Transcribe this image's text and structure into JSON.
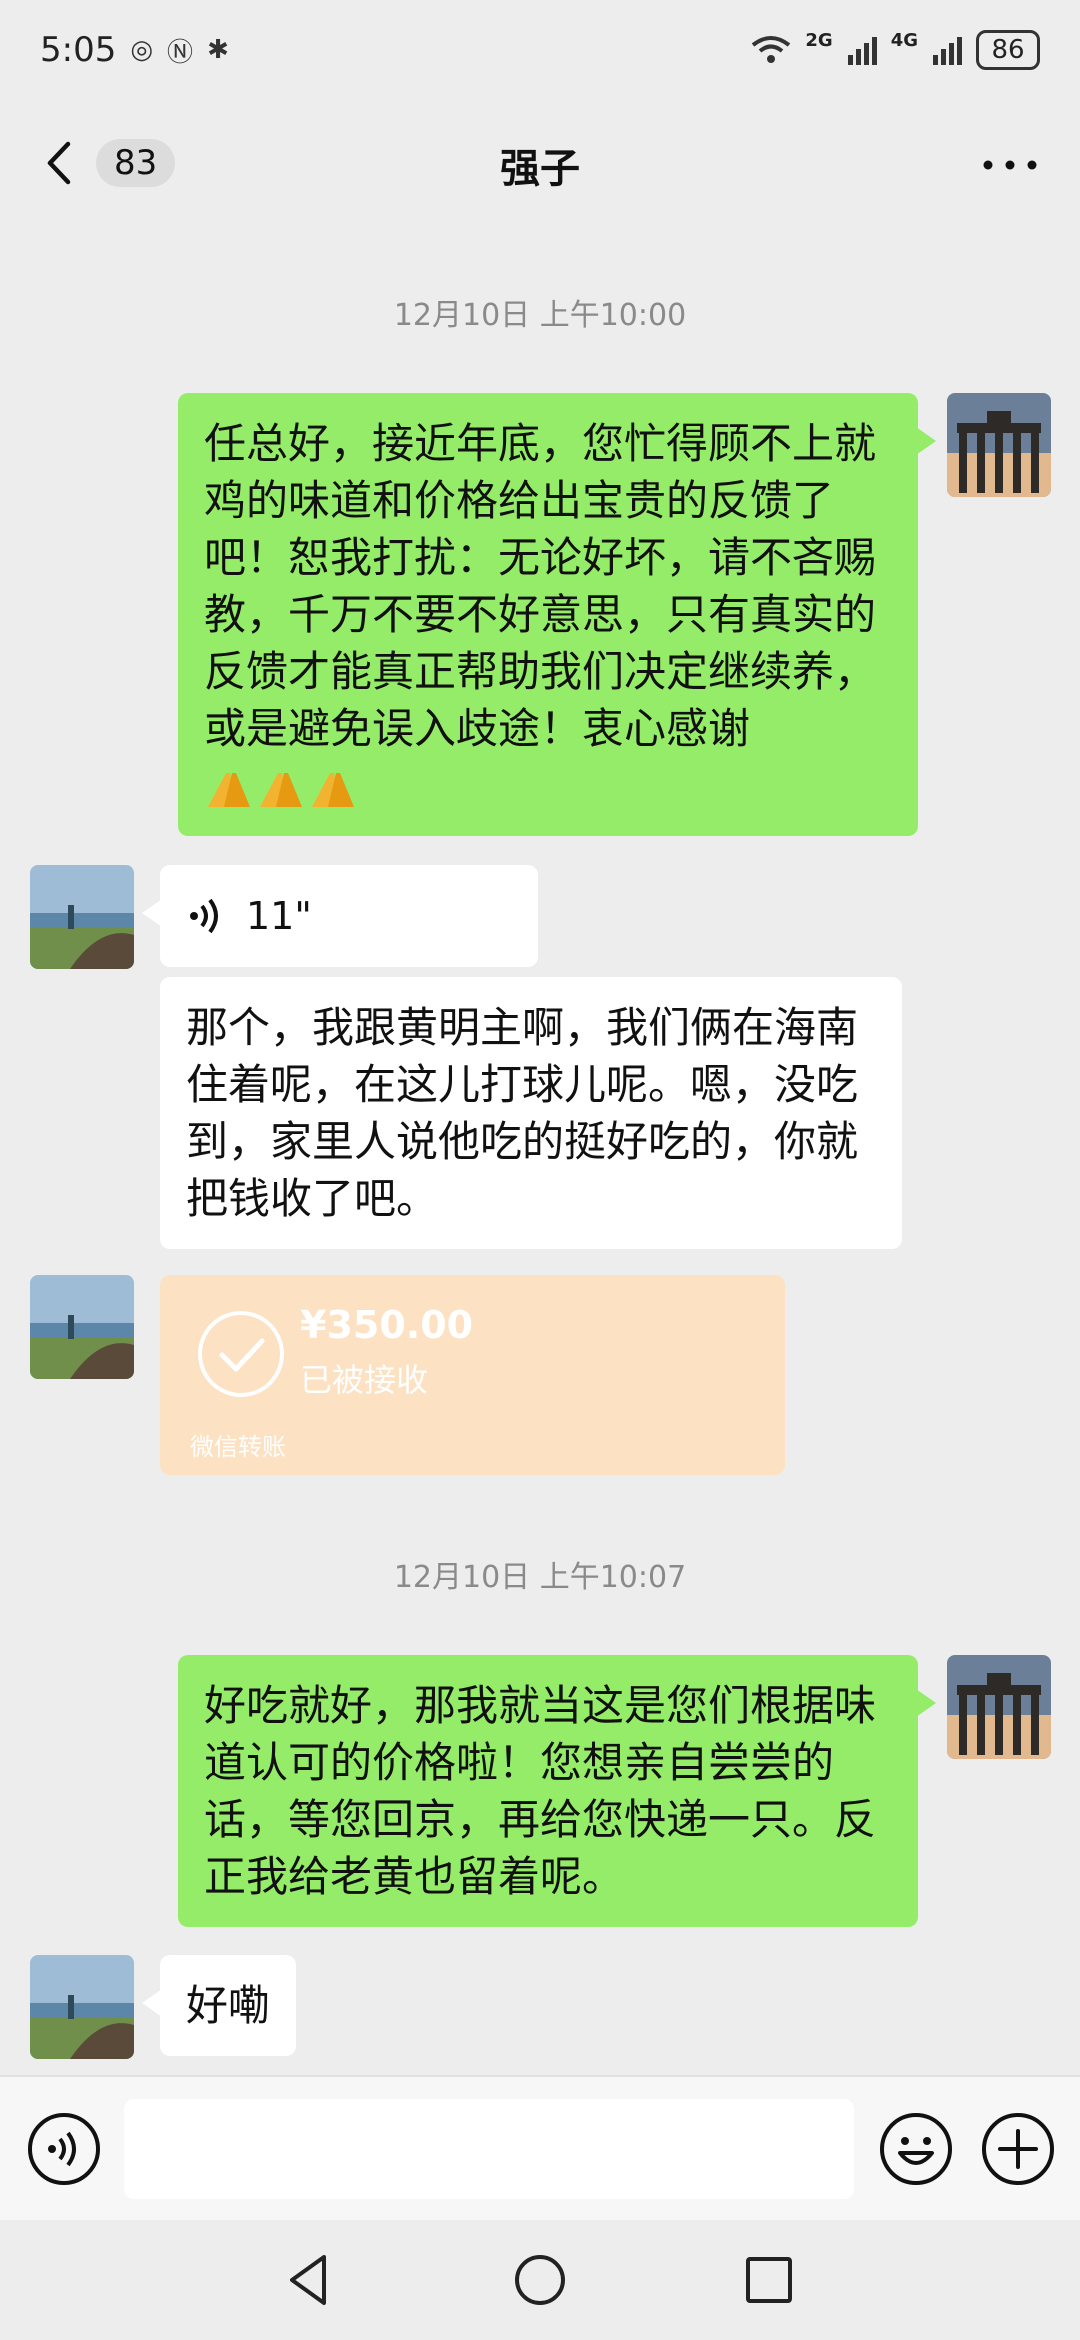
{
  "status_bar": {
    "time": "5:05",
    "network_1": "2G",
    "network_2": "4G",
    "battery": "86"
  },
  "header": {
    "back_badge": "83",
    "title": "强子"
  },
  "messages": {
    "ts1": "12月10日 上午10:00",
    "m1_text": "任总好，接近年底，您忙得顾不上就鸡的味道和价格给出宝贵的反馈了吧！恕我打扰：无论好坏，请不吝赐教，千万不要不好意思，只有真实的反馈才能真正帮助我们决定继续养，或是避免误入歧途！衷心感谢",
    "voice_duration": "11\"",
    "voice_transcript": "那个，我跟黄明主啊，我们俩在海南住着呢，在这儿打球儿呢。嗯，没吃到，家里人说他吃的挺好吃的，你就把钱收了吧。",
    "transfer_amount": "¥350.00",
    "transfer_status": "已被接收",
    "transfer_label": "微信转账",
    "ts2": "12月10日 上午10:07",
    "m2_text": "好吃就好，那我就当这是您们根据味道认可的价格啦！您想亲自尝尝的话，等您回京，再给您快递一只。反正我给老黄也留着呢。",
    "m3_text": "好嘞"
  },
  "input": {
    "value": ""
  },
  "colors": {
    "sent_bubble": "#95ec69",
    "received_bubble": "#ffffff",
    "transfer_bg": "#fde1c3",
    "background": "#ededed"
  },
  "icons": {
    "back": "chevron-left-icon",
    "more": "more-dots-icon",
    "voice_mode": "voice-icon",
    "emoji": "emoji-icon",
    "plus": "plus-icon",
    "nav_back": "triangle-back-icon",
    "nav_home": "circle-home-icon",
    "nav_recents": "square-recents-icon"
  }
}
